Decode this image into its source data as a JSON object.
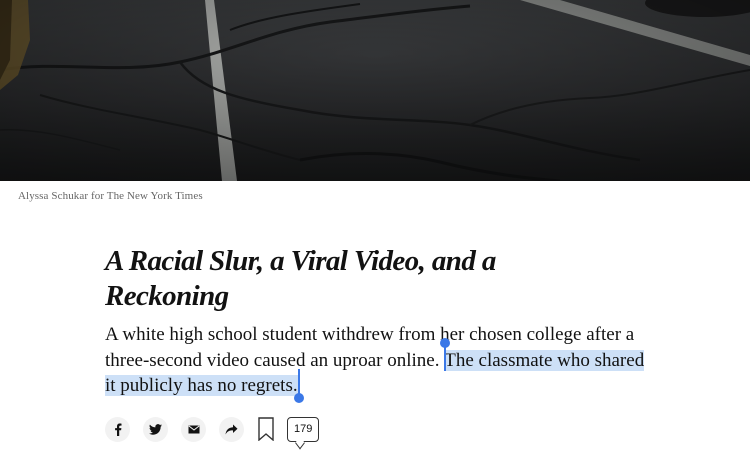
{
  "photo": {
    "caption": "Alyssa Schukar for The New York Times",
    "description_icon": "photo-asphalt-parking-lot"
  },
  "article": {
    "headline": "A Racial Slur, a Viral Video, and a Reckoning",
    "summary_unselected": "A white high school student withdrew from her chosen college after a three-second video caused an uproar online. ",
    "summary_selected": "The classmate who shared it publicly has no regrets."
  },
  "share": {
    "items": [
      {
        "name": "facebook",
        "icon": "facebook-icon"
      },
      {
        "name": "twitter",
        "icon": "twitter-icon"
      },
      {
        "name": "email",
        "icon": "mail-icon"
      },
      {
        "name": "more",
        "icon": "share-arrow-icon"
      }
    ],
    "save_icon": "bookmark-icon",
    "comment_count": "179"
  },
  "colors": {
    "selection": "#cde0f7",
    "selection_handle": "#3b78e7",
    "text": "#121212",
    "caption": "#666666"
  }
}
